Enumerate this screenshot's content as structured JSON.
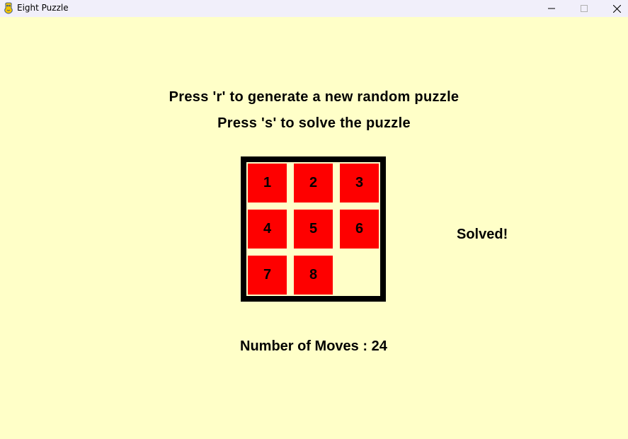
{
  "window": {
    "title": "Eight Puzzle",
    "icon": "pygame-snake-icon",
    "controls": [
      "minimize-icon",
      "maximize-icon",
      "close-icon"
    ]
  },
  "instructions": {
    "line1": "Press 'r' to generate a new random puzzle",
    "line2": "Press 's' to solve the puzzle"
  },
  "board": {
    "grid_size": 3,
    "tiles": [
      "1",
      "2",
      "3",
      "4",
      "5",
      "6",
      "7",
      "8",
      ""
    ]
  },
  "status": "Solved!",
  "moves": {
    "label": "Number of Moves : ",
    "count": "24"
  },
  "colors": {
    "background": "#ffffc8",
    "tile": "#fe0000",
    "board_border": "#000000",
    "titlebar": "#f1effa"
  }
}
